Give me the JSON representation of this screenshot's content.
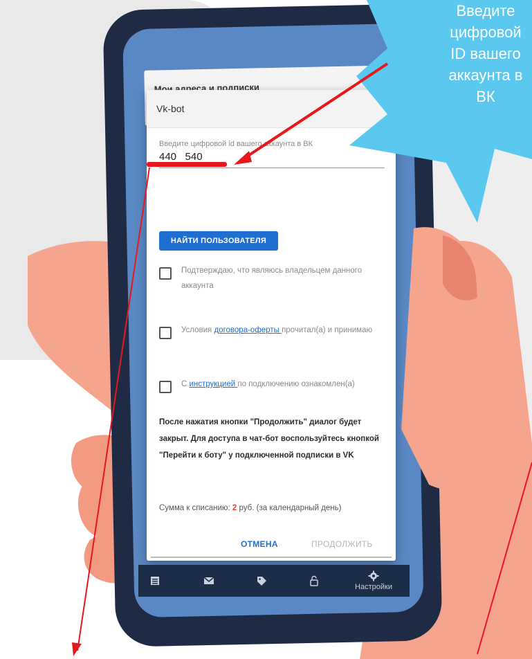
{
  "behind_screen": {
    "title": "Мои адреса и подписки"
  },
  "dialog": {
    "title": "Vk-bot",
    "field": {
      "label": "Введите цифровой id вашего аккаунта в ВК",
      "value": "440 ‍ ‍ ‍540"
    },
    "find_button": "НАЙТИ ПОЛЬЗОВАТЕЛЯ",
    "checks": [
      {
        "text": "Подтверждаю, что являюсь владельцем данного аккаунта"
      },
      {
        "before": "Условия ",
        "link": "договора-оферты ",
        "after": "прочитал(а) и принимаю"
      },
      {
        "before": "С ",
        "link": "инструкцией ",
        "after": "по подключению ознакомлен(а)"
      }
    ],
    "info": "После нажатия кнопки \"Продолжить\" диалог будет закрыт. Для доступа в чат-бот воспользуйтесь кнопкой \"Перейти к боту\" у подключенной подписки в VK",
    "sum": {
      "prefix": "Сумма к списанию: ",
      "amount": "2",
      "suffix": " руб. (за календарный день)"
    },
    "cancel": "ОТМЕНА",
    "continue": "ПРОДОЛЖИТЬ"
  },
  "tabbar": {
    "items": [
      {
        "icon": "list-icon"
      },
      {
        "icon": "mail-icon"
      },
      {
        "icon": "tag-icon"
      },
      {
        "icon": "lock-icon"
      },
      {
        "icon": "gear-icon",
        "label": "Настройки"
      }
    ]
  },
  "callout": {
    "lines": [
      "Введите",
      "цифровой",
      "ID вашего",
      "аккаунта в",
      "ВК"
    ],
    "color": "#5bc8f0"
  },
  "colors": {
    "arrow": "#e8171e",
    "primary": "#1e6fd0",
    "skin": "#f5a58e"
  }
}
